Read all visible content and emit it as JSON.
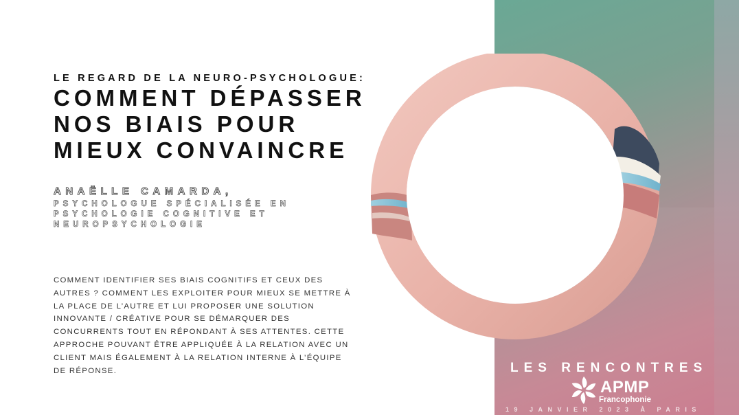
{
  "header": {
    "subtitle": "LE REGARD DE LA NEURO-PSYCHOLOGUE:",
    "title_lines": [
      "COMMENT DÉPASSER",
      "NOS BIAIS POUR",
      "MIEUX CONVAINCRE"
    ]
  },
  "author": {
    "name": "ANAËLLE CAMARDA,",
    "role_lines": [
      "PSYCHOLOGUE SPÉCIALISÉE EN",
      "PSYCHOLOGIE COGNITIVE ET",
      "NEUROPSYCHOLOGIE"
    ]
  },
  "description_lines": [
    "COMMENT IDENTIFIER SES BIAIS COGNITIFS ET CEUX DES",
    "AUTRES ? COMMENT LES EXPLOITER POUR MIEUX SE METTRE À",
    "LA PLACE DE L’AUTRE ET LUI PROPOSER UNE SOLUTION",
    "INNOVANTE / CRÉATIVE POUR SE DÉMARQUER DES",
    "CONCURRENTS TOUT EN RÉPONDANT À SES ATTENTES. CETTE",
    "APPROCHE POUVANT ÊTRE APPLIQUÉE À LA RELATION AVEC UN",
    "CLIENT MAIS ÉGALEMENT À LA RELATION INTERNE À L’ÉQUIPE",
    "DE RÉPONSE."
  ],
  "event": {
    "title": "LES RENCONTRES",
    "logo_text": "APMP",
    "logo_sub": "Francophonie",
    "date": "19 JANVIER 2023 À PARIS"
  },
  "colors": {
    "panel_top": "#6aa895",
    "panel_bottom": "#c9788c",
    "ring": "#e8aea6"
  },
  "icons": [
    "ring-graphic-icon",
    "apmp-logo-icon"
  ]
}
